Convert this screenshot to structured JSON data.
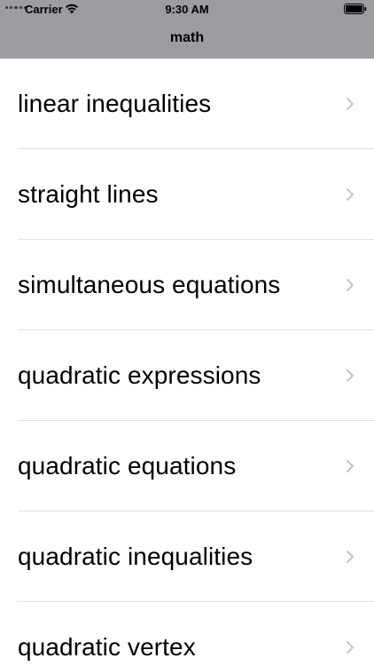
{
  "status_bar": {
    "carrier": "Carrier",
    "time": "9:30 AM",
    "wifi_icon": "wifi-icon",
    "battery_icon": "battery-icon"
  },
  "nav": {
    "title": "math",
    "background": "#9d9da1"
  },
  "list": {
    "items": [
      {
        "label": "linear inequalities",
        "icon": "chevron-right-icon"
      },
      {
        "label": "straight lines",
        "icon": "chevron-right-icon"
      },
      {
        "label": "simultaneous equations",
        "icon": "chevron-right-icon"
      },
      {
        "label": "quadratic expressions",
        "icon": "chevron-right-icon"
      },
      {
        "label": "quadratic equations",
        "icon": "chevron-right-icon"
      },
      {
        "label": "quadratic inequalities",
        "icon": "chevron-right-icon"
      },
      {
        "label": "quadratic vertex",
        "icon": "chevron-right-icon"
      }
    ]
  }
}
